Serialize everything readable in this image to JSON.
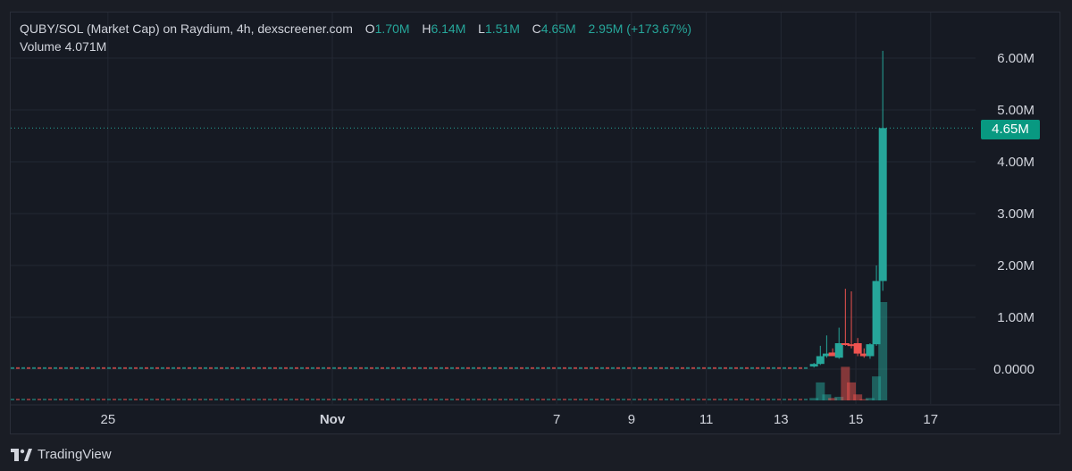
{
  "legend": {
    "title": "QUBY/SOL (Market Cap) on Raydium, 4h, dexscreener.com",
    "open_label": "O",
    "open": "1.70M",
    "high_label": "H",
    "high": "6.14M",
    "low_label": "L",
    "low": "1.51M",
    "close_label": "C",
    "close": "4.65M",
    "change": "2.95M (+173.67%)",
    "volume_label": "Volume",
    "volume": "4.071M"
  },
  "last_price_label": "4.65M",
  "footer": {
    "brand": "TradingView",
    "logo_icon": "tradingview-logo-icon"
  },
  "colors": {
    "up": "#26a69a",
    "down": "#ef5350",
    "background": "#161a23",
    "grid": "#232833",
    "text": "#d1d4dc",
    "last_price_bg": "#089981"
  },
  "chart_data": {
    "type": "candlestick",
    "title": "QUBY/SOL (Market Cap) on Raydium, 4h, dexscreener.com",
    "interval": "4h",
    "y_axis_ticks": [
      "6.00M",
      "5.00M",
      "4.00M",
      "3.00M",
      "2.00M",
      "1.00M",
      "0.0000"
    ],
    "ylim": [
      -0.6,
      6.3
    ],
    "x_axis_ticks": [
      "25",
      "Nov",
      "7",
      "9",
      "11",
      "13",
      "15",
      "17"
    ],
    "x_tick_days": [
      -6,
      0,
      6,
      8,
      10,
      12,
      14,
      16
    ],
    "xlim": [
      -8.6,
      17.2
    ],
    "last_price": 4.65,
    "flat_period": {
      "from_day": -8.6,
      "to_day": 12.7,
      "value": 0.02,
      "series": "near-zero dashed candles"
    },
    "candles": [
      {
        "day": 12.88,
        "o": 0.05,
        "h": 0.12,
        "l": 0.03,
        "c": 0.1
      },
      {
        "day": 13.05,
        "o": 0.1,
        "h": 0.45,
        "l": 0.08,
        "c": 0.25
      },
      {
        "day": 13.22,
        "o": 0.25,
        "h": 0.65,
        "l": 0.22,
        "c": 0.3
      },
      {
        "day": 13.38,
        "o": 0.32,
        "h": 0.4,
        "l": 0.25,
        "c": 0.25
      },
      {
        "day": 13.55,
        "o": 0.22,
        "h": 0.8,
        "l": 0.2,
        "c": 0.5
      },
      {
        "day": 13.72,
        "o": 0.5,
        "h": 1.55,
        "l": 0.45,
        "c": 0.48
      },
      {
        "day": 13.88,
        "o": 0.48,
        "h": 1.5,
        "l": 0.4,
        "c": 0.47
      },
      {
        "day": 14.05,
        "o": 0.5,
        "h": 0.6,
        "l": 0.25,
        "c": 0.3
      },
      {
        "day": 14.22,
        "o": 0.3,
        "h": 0.4,
        "l": 0.22,
        "c": 0.25
      },
      {
        "day": 14.38,
        "o": 0.25,
        "h": 0.5,
        "l": 0.2,
        "c": 0.48
      },
      {
        "day": 14.55,
        "o": 0.48,
        "h": 2.0,
        "l": 0.45,
        "c": 1.7
      },
      {
        "day": 14.72,
        "o": 1.7,
        "h": 6.14,
        "l": 1.51,
        "c": 4.65
      }
    ],
    "volume": [
      {
        "day": 12.88,
        "v": 0.02,
        "up": true
      },
      {
        "day": 13.05,
        "v": 0.15,
        "up": true
      },
      {
        "day": 13.22,
        "v": 0.05,
        "up": true
      },
      {
        "day": 13.38,
        "v": 0.02,
        "up": false
      },
      {
        "day": 13.55,
        "v": 0.03,
        "up": true
      },
      {
        "day": 13.72,
        "v": 0.28,
        "up": false
      },
      {
        "day": 13.88,
        "v": 0.15,
        "up": false
      },
      {
        "day": 14.05,
        "v": 0.05,
        "up": false
      },
      {
        "day": 14.22,
        "v": 0.01,
        "up": false
      },
      {
        "day": 14.38,
        "v": 0.02,
        "up": true
      },
      {
        "day": 14.55,
        "v": 0.2,
        "up": true
      },
      {
        "day": 14.72,
        "v": 0.82,
        "up": true
      }
    ]
  }
}
